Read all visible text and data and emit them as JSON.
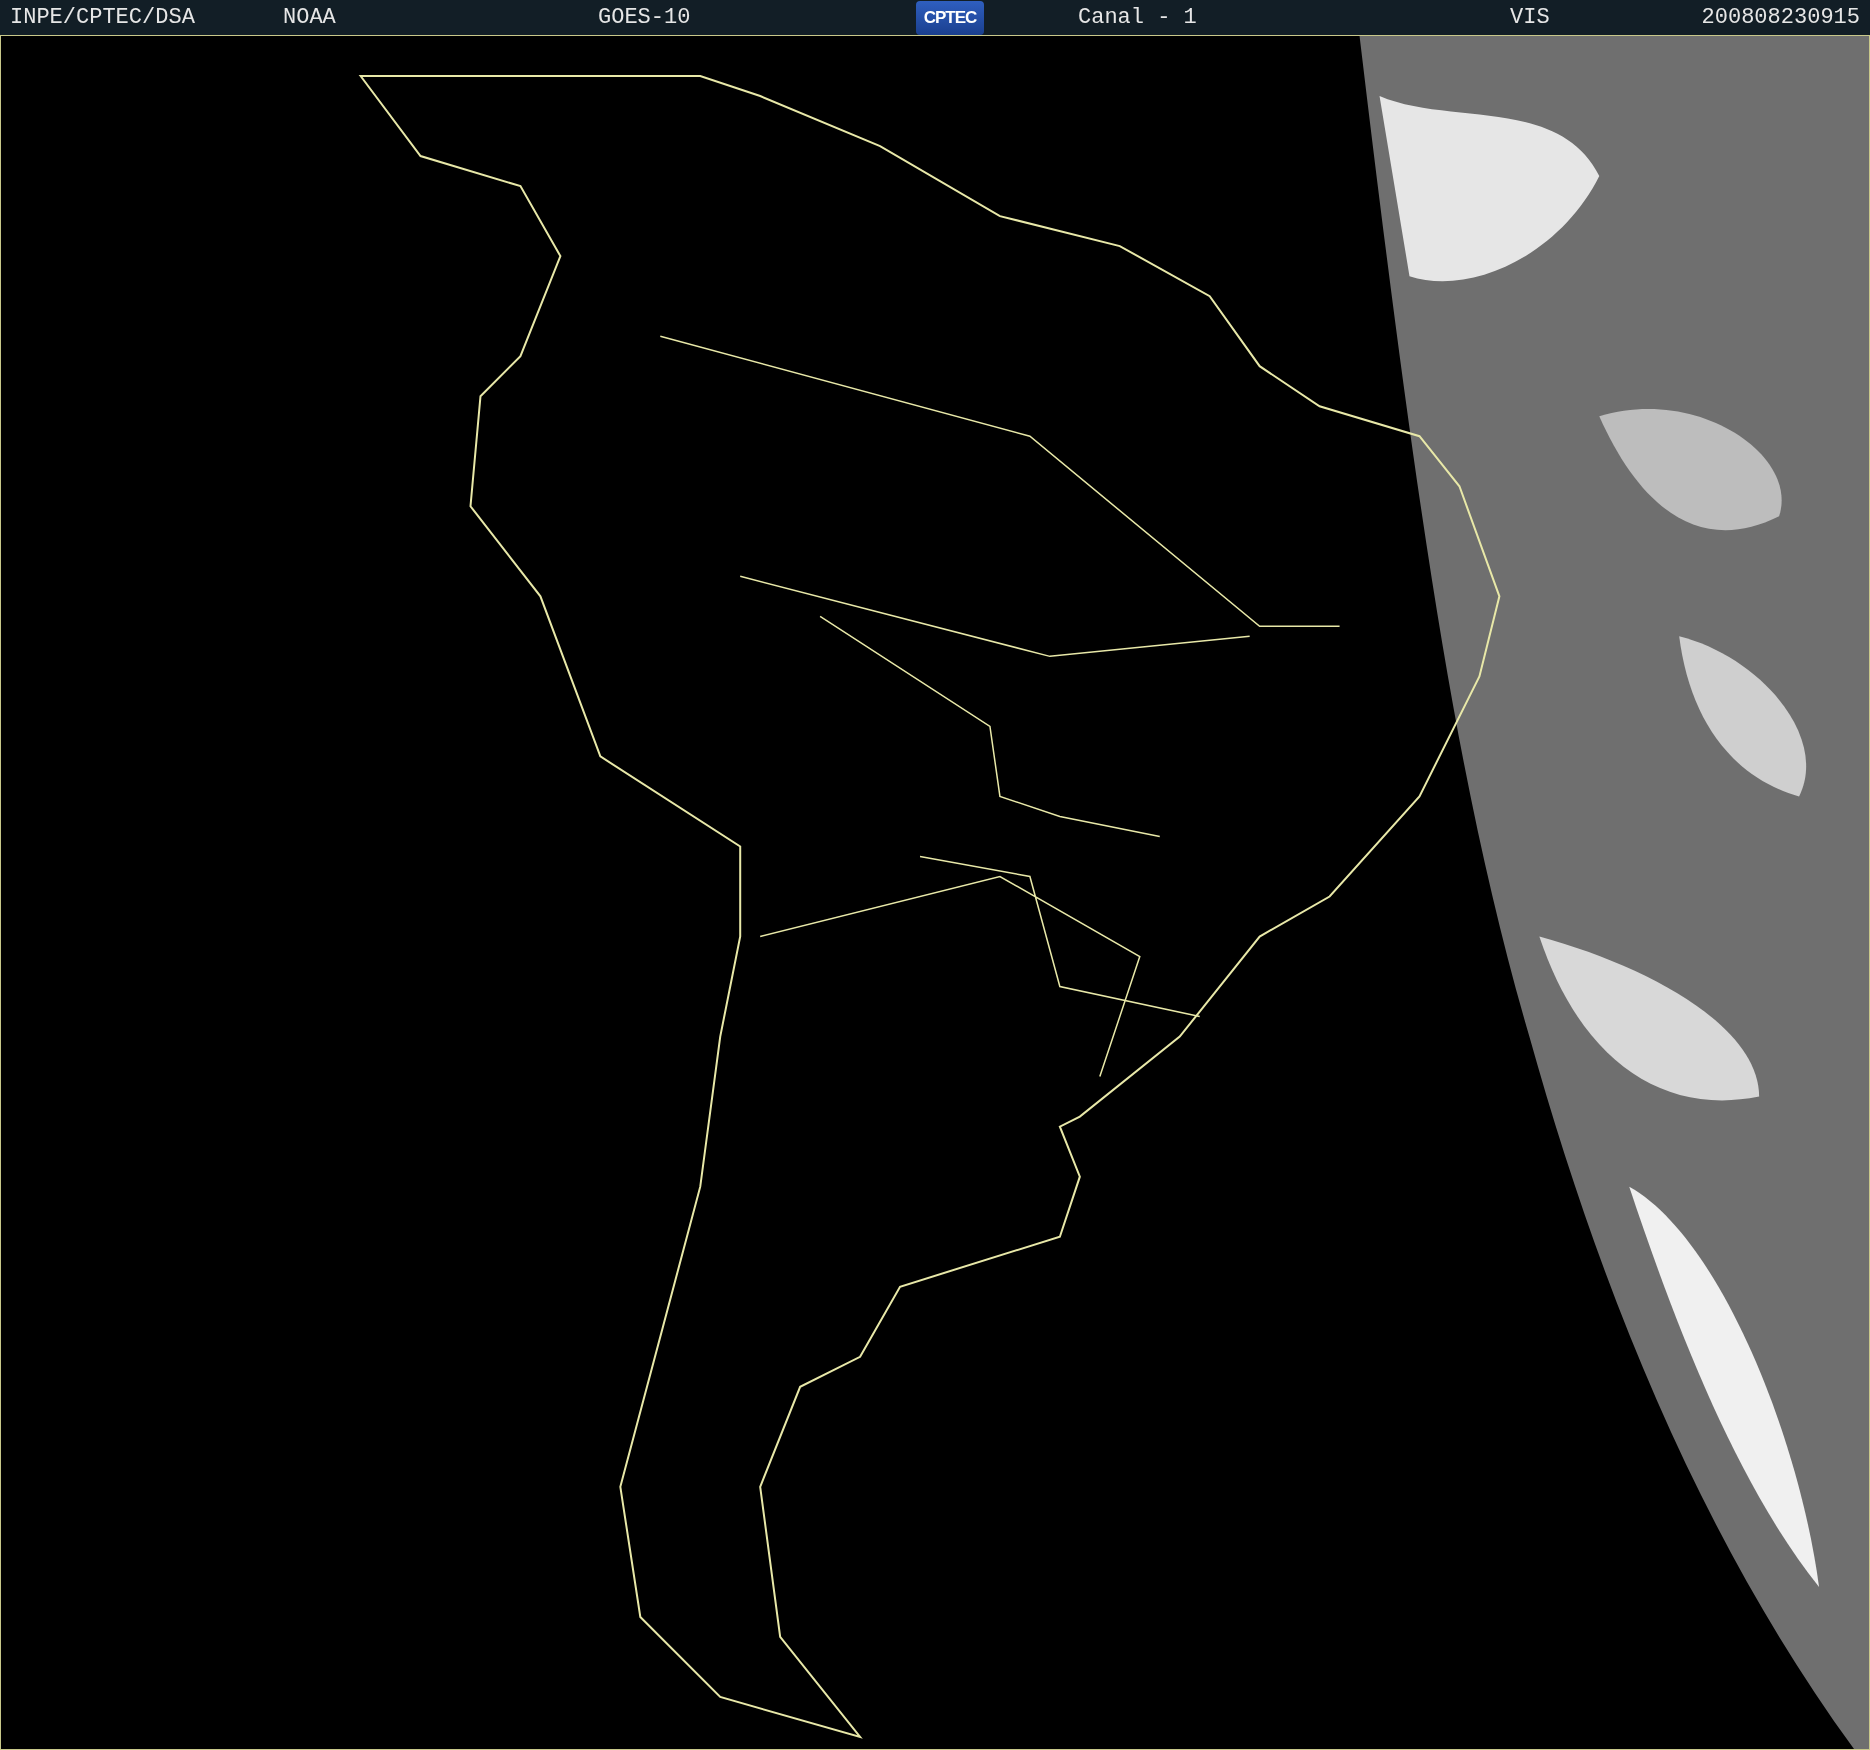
{
  "header": {
    "items": [
      {
        "kind": "text",
        "text": "INPE/CPTEC/DSA"
      },
      {
        "kind": "text",
        "text": "NOAA"
      },
      {
        "kind": "text",
        "text": "GOES-10"
      },
      {
        "kind": "logo",
        "text": "CPTEC"
      },
      {
        "kind": "text",
        "text": "Canal - 1"
      },
      {
        "kind": "text",
        "text": "VIS"
      },
      {
        "kind": "text",
        "text": "200808230915"
      }
    ]
  }
}
